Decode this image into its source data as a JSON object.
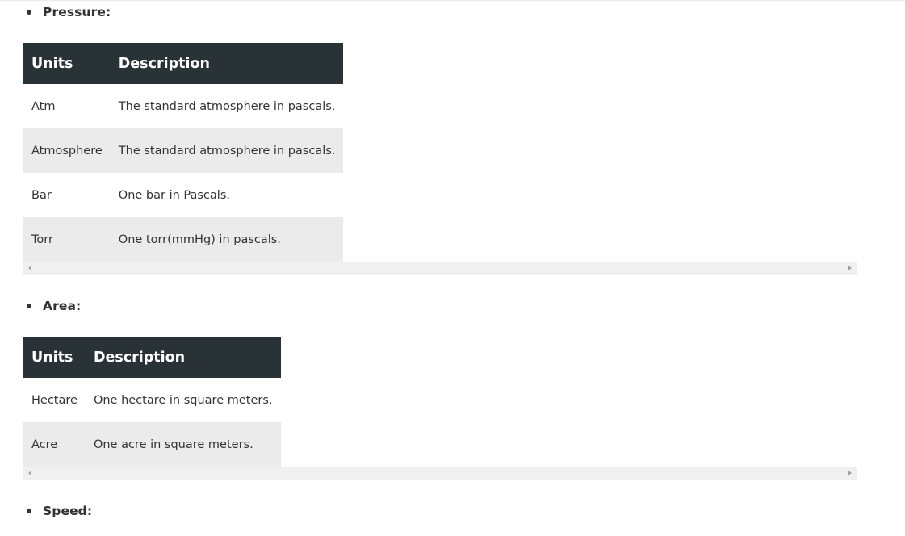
{
  "sections": {
    "pressure": {
      "title": "Pressure:",
      "headers": {
        "units": "Units",
        "description": "Description"
      },
      "rows": [
        {
          "unit": "Atm",
          "description": "The standard atmosphere in pascals."
        },
        {
          "unit": "Atmosphere",
          "description": "The standard atmosphere in pascals."
        },
        {
          "unit": "Bar",
          "description": "One bar in Pascals."
        },
        {
          "unit": "Torr",
          "description": "One torr(mmHg) in pascals."
        }
      ]
    },
    "area": {
      "title": "Area:",
      "headers": {
        "units": "Units",
        "description": "Description"
      },
      "rows": [
        {
          "unit": "Hectare",
          "description": "One hectare in square meters."
        },
        {
          "unit": "Acre",
          "description": "One acre in square meters."
        }
      ]
    },
    "speed": {
      "title": "Speed:"
    }
  },
  "colors": {
    "header_bg": "#283237",
    "row_alt_bg": "#ebebeb",
    "text": "#333333",
    "scrollbar_bg": "#f0f0f0"
  }
}
